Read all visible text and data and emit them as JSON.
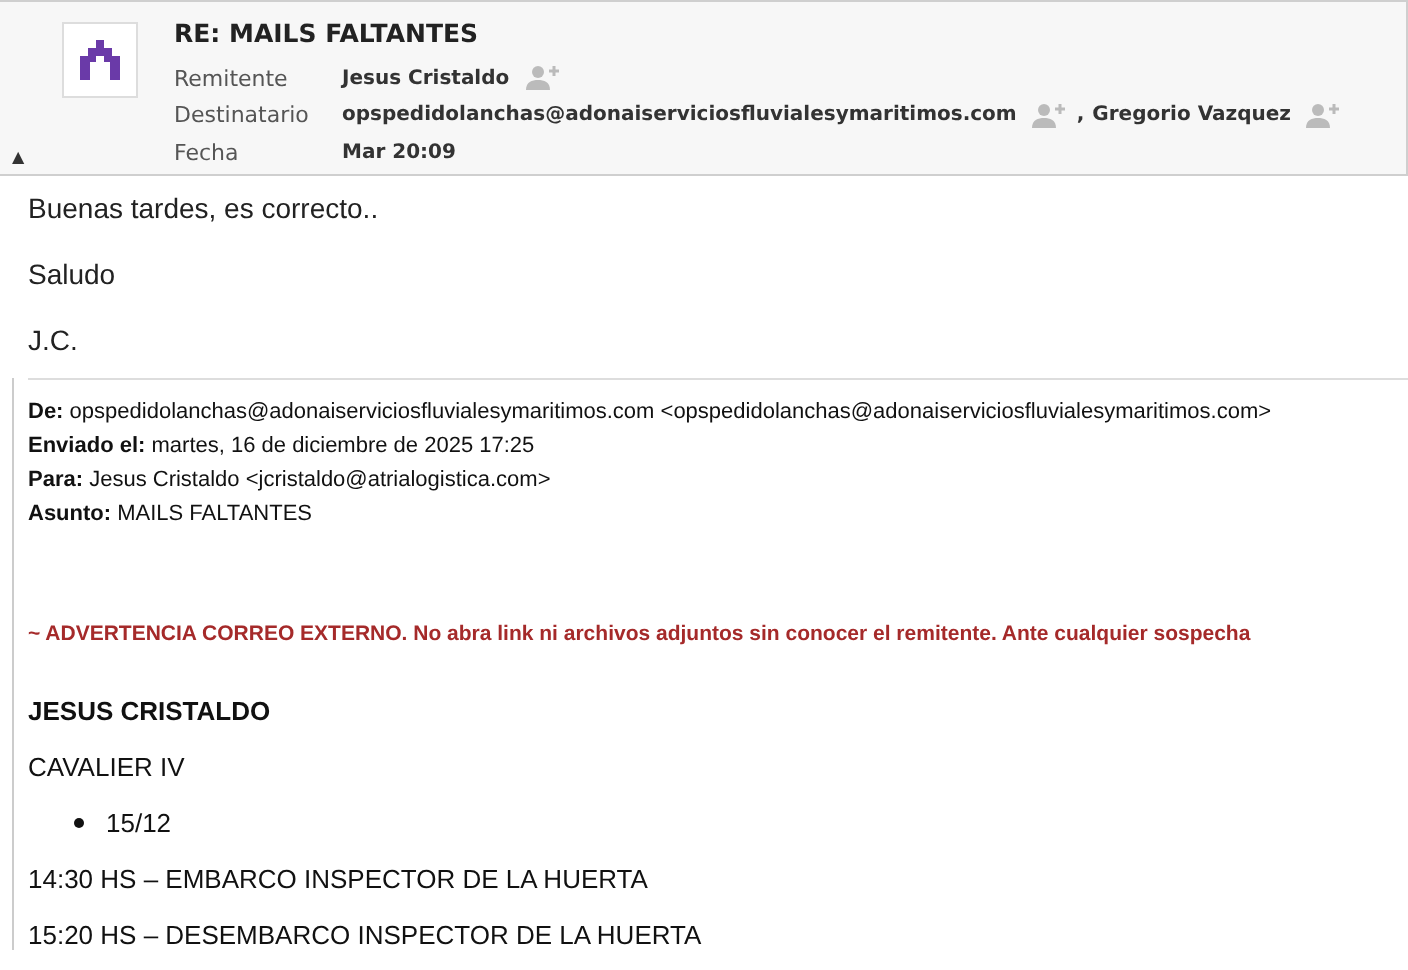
{
  "header": {
    "subject": "RE: MAILS FALTANTES",
    "collapse_icon": "▲",
    "fields": [
      {
        "label": "Remitente",
        "people": [
          {
            "name": "Jesus Cristaldo"
          }
        ]
      },
      {
        "label": "Destinatario",
        "separator": ",",
        "people": [
          {
            "name": "opspedidolanchas@adonaiserviciosfluvialesymaritimos.com"
          },
          {
            "name": "Gregorio Vazquez"
          }
        ]
      },
      {
        "label": "Fecha",
        "value": "Mar 20:09"
      }
    ]
  },
  "body": {
    "paragraphs": [
      "Buenas tardes, es correcto..",
      "Saludo",
      "J.C."
    ]
  },
  "quoted": {
    "meta": [
      {
        "label": "De:",
        "value": "opspedidolanchas@adonaiserviciosfluvialesymaritimos.com <opspedidolanchas@adonaiserviciosfluvialesymaritimos.com>"
      },
      {
        "label": "Enviado el:",
        "value": "martes, 16 de diciembre de 2025 17:25"
      },
      {
        "label": "Para:",
        "value": "Jesus Cristaldo <jcristaldo@atrialogistica.com>"
      },
      {
        "label": "Asunto:",
        "value": "MAILS FALTANTES"
      }
    ],
    "warning": "~ ADVERTENCIA CORREO EXTERNO. No abra link ni archivos adjuntos sin conocer el remitente. Ante cualquier sospecha",
    "blocks": [
      {
        "kind": "heading",
        "text": "JESUS CRISTALDO"
      },
      {
        "kind": "para",
        "text": "CAVALIER IV"
      },
      {
        "kind": "bullet",
        "text": "15/12"
      },
      {
        "kind": "para",
        "text": "14:30 HS – EMBARCO INSPECTOR DE LA HUERTA"
      },
      {
        "kind": "para",
        "text": "15:20 HS – DESEMBARCO INSPECTOR DE LA HUERTA"
      }
    ]
  }
}
